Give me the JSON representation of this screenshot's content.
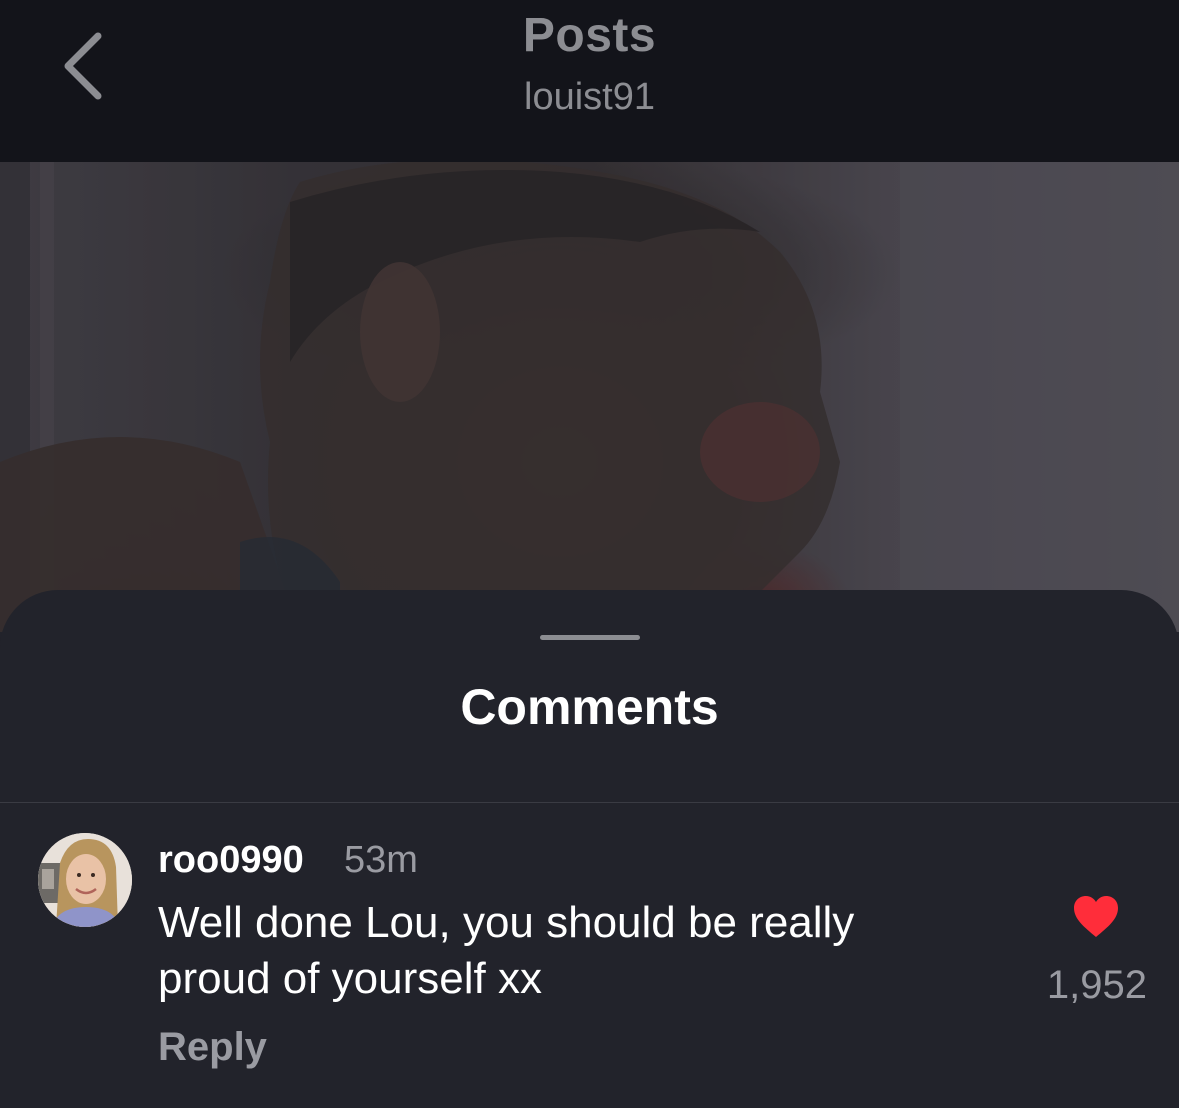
{
  "header": {
    "title": "Posts",
    "username": "louist91",
    "back_icon": "chevron-left-icon"
  },
  "post": {
    "image_icon": "post-photo"
  },
  "comments_sheet": {
    "title": "Comments",
    "comments": [
      {
        "username": "roo0990",
        "time": "53m",
        "text": "Well done Lou, you should be really proud of yourself xx",
        "reply_label": "Reply",
        "like_count": "1,952",
        "liked": true,
        "like_color": "#ff2d3a",
        "like_icon": "heart-icon"
      }
    ]
  },
  "colors": {
    "header_bg": "#13141a",
    "sheet_bg": "#22232b",
    "muted_text": "#9a9ba2",
    "heart": "#ff2d3a"
  }
}
